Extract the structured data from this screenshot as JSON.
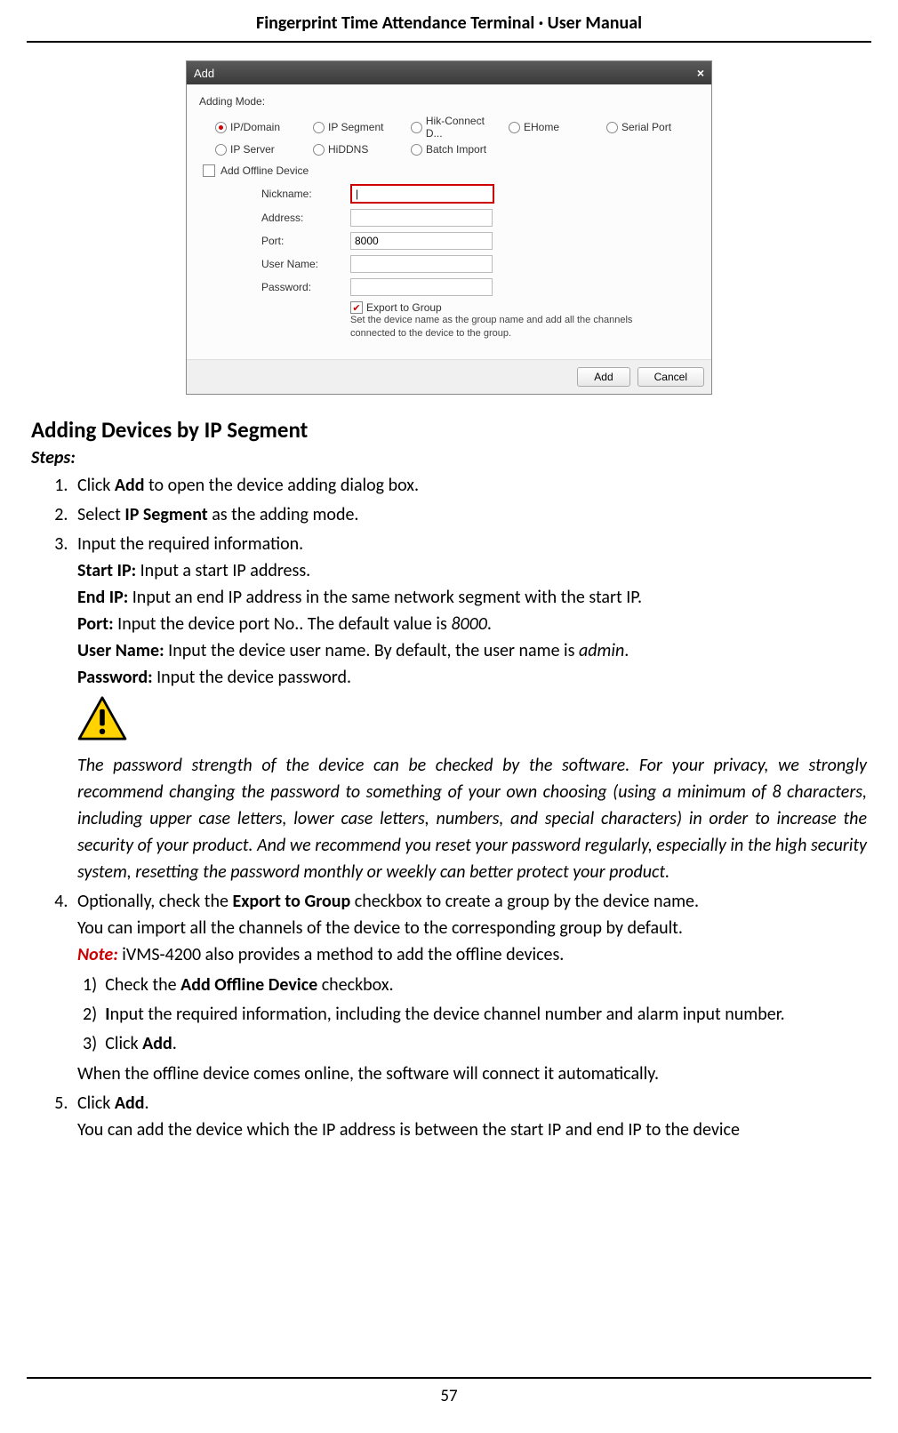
{
  "header": {
    "title": "Fingerprint Time Attendance Terminal · User Manual"
  },
  "footer": {
    "page_number": "57"
  },
  "dialog": {
    "title": "Add",
    "close_label": "×",
    "adding_mode_label": "Adding Mode:",
    "radios_row1": [
      {
        "label": "IP/Domain",
        "checked": true
      },
      {
        "label": "IP Segment",
        "checked": false
      },
      {
        "label": "Hik-Connect D...",
        "checked": false
      },
      {
        "label": "EHome",
        "checked": false
      },
      {
        "label": "Serial Port",
        "checked": false
      }
    ],
    "radios_row2": [
      {
        "label": "IP Server",
        "checked": false
      },
      {
        "label": "HiDDNS",
        "checked": false
      },
      {
        "label": "Batch Import",
        "checked": false
      }
    ],
    "offline_checkbox_label": "Add Offline Device",
    "fields": {
      "nickname_label": "Nickname:",
      "nickname_value": "|",
      "address_label": "Address:",
      "address_value": "",
      "port_label": "Port:",
      "port_value": "8000",
      "username_label": "User Name:",
      "username_value": "",
      "password_label": "Password:",
      "password_value": ""
    },
    "export_checkbox_label": "Export to Group",
    "export_note": "Set the device name as the group name and add all the channels connected to the device to the group.",
    "add_button": "Add",
    "cancel_button": "Cancel"
  },
  "section": {
    "heading": "Adding Devices by IP Segment",
    "steps_label": "Steps:"
  },
  "steps": {
    "s1_pre": "Click ",
    "s1_bold": "Add",
    "s1_post": " to open the device adding dialog box.",
    "s2_pre": "Select ",
    "s2_bold": "IP Segment",
    "s2_post": " as the adding mode.",
    "s3": "Input the required information.",
    "s3_startip_label": "Start IP:",
    "s3_startip_text": " Input a start IP address.",
    "s3_endip_label": "End IP:",
    "s3_endip_text": " Input an end IP address in the same network segment with the start IP.",
    "s3_port_label": "Port:",
    "s3_port_text_pre": " Input the device port No.. The default value is ",
    "s3_port_val": "8000",
    "s3_port_text_post": ".",
    "s3_user_label": "User Name:",
    "s3_user_text_pre": " Input the device user name. By default, the user name is ",
    "s3_user_val": "admin",
    "s3_user_text_post": ".",
    "s3_pass_label": "Password:",
    "s3_pass_text": " Input the device password.",
    "warning_text": "The password strength of the device can be checked by the software. For your privacy, we strongly recommend changing the password to something of your own choosing (using a minimum of 8 characters, including upper case letters, lower case letters, numbers, and special characters) in order to increase the security of your product. And we recommend you reset your password regularly, especially in the high security system, resetting the password monthly or weekly can better protect your product.",
    "s4_pre": "Optionally, check the ",
    "s4_bold": "Export to Group",
    "s4_post": " checkbox to create a group by the device name.",
    "s4_line2": "You can import all the channels of the device to the corresponding group by default.",
    "s4_note_label": "Note:",
    "s4_note_text": " iVMS-4200 also provides a method to add the offline devices.",
    "s4_sub1_pre": "Check the ",
    "s4_sub1_bold": "Add Offline Device",
    "s4_sub1_post": " checkbox.",
    "s4_sub2_pre": "I",
    "s4_sub2_rest": "nput the required information, including the device channel number and alarm input number.",
    "s4_sub3_pre": "Click ",
    "s4_sub3_bold": "Add",
    "s4_sub3_post": ".",
    "s4_post_sub": "When the offline device comes online, the software will connect it automatically.",
    "s5_pre": "Click ",
    "s5_bold": "Add",
    "s5_post": ".",
    "s5_line2": "You can add the device which the IP address is between the start IP and end IP to the device"
  }
}
